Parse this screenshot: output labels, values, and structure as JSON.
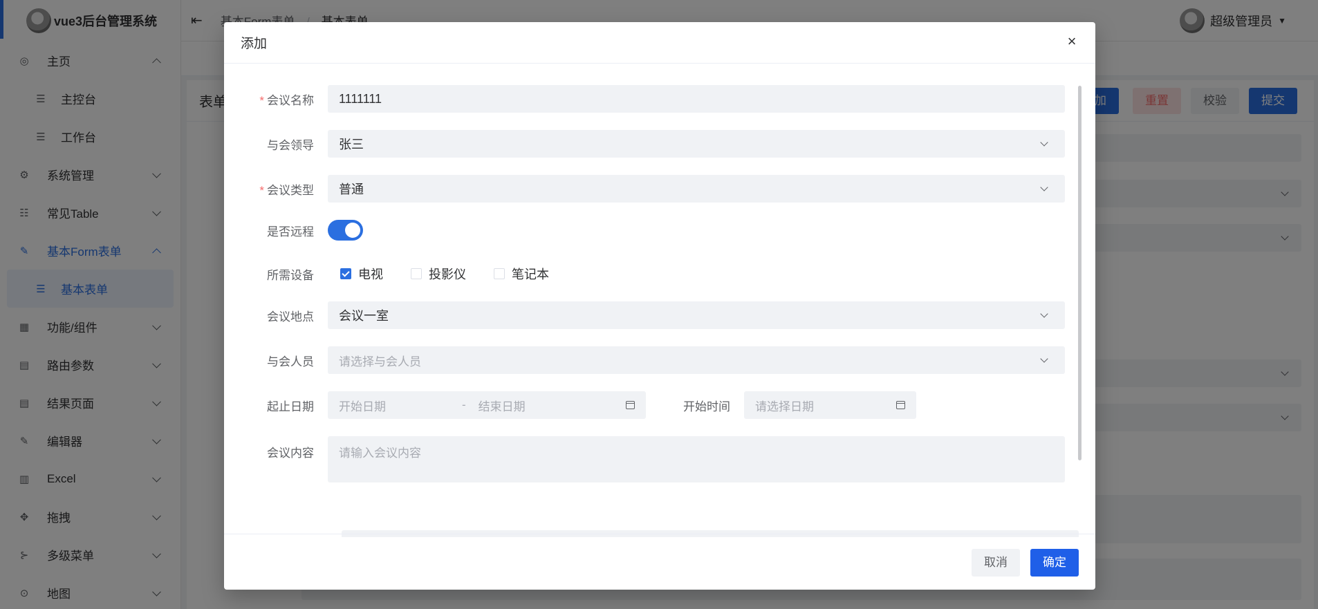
{
  "app": {
    "title": "vue3后台管理系统"
  },
  "sidebar": {
    "items": [
      {
        "label": "主页",
        "icon": "dashboard-icon"
      },
      {
        "label": "主控台",
        "icon": "list-icon"
      },
      {
        "label": "工作台",
        "icon": "list-icon"
      },
      {
        "label": "系统管理",
        "icon": "gear-icon"
      },
      {
        "label": "常见Table",
        "icon": "list-icon"
      },
      {
        "label": "基本Form表单",
        "icon": "edit-icon"
      },
      {
        "label": "基本表单",
        "icon": "list-icon"
      },
      {
        "label": "功能/组件",
        "icon": "grid-icon"
      },
      {
        "label": "路由参数",
        "icon": "document-icon"
      },
      {
        "label": "结果页面",
        "icon": "document-icon"
      },
      {
        "label": "编辑器",
        "icon": "edit-icon"
      },
      {
        "label": "Excel",
        "icon": "table-icon"
      },
      {
        "label": "拖拽",
        "icon": "move-icon"
      },
      {
        "label": "多级菜单",
        "icon": "share-icon"
      },
      {
        "label": "地图",
        "icon": "location-icon"
      }
    ]
  },
  "header": {
    "breadcrumb": [
      "基本Form表单",
      "基本表单"
    ],
    "user": "超级管理员"
  },
  "page": {
    "card_title": "表单",
    "buttons": {
      "add": "添加",
      "reset": "重置",
      "validate": "校验",
      "submit": "提交"
    }
  },
  "dialog": {
    "title": "添加",
    "close": "×",
    "form": {
      "name": {
        "label": "会议名称",
        "value": "1111111",
        "required": true
      },
      "leader": {
        "label": "与会领导",
        "value": "张三"
      },
      "type": {
        "label": "会议类型",
        "value": "普通",
        "required": true
      },
      "remote": {
        "label": "是否远程",
        "value": true
      },
      "devices": {
        "label": "所需设备",
        "options": [
          {
            "label": "电视",
            "checked": true
          },
          {
            "label": "投影仪",
            "checked": false
          },
          {
            "label": "笔记本",
            "checked": false
          }
        ]
      },
      "location": {
        "label": "会议地点",
        "value": "会议一室"
      },
      "attendees": {
        "label": "与会人员",
        "placeholder": "请选择与会人员"
      },
      "date_range": {
        "label": "起止日期",
        "start_placeholder": "开始日期",
        "separator": "-",
        "end_placeholder": "结束日期"
      },
      "start_time": {
        "label": "开始时间",
        "placeholder": "请选择日期"
      },
      "content": {
        "label": "会议内容",
        "placeholder": "请输入会议内容"
      }
    },
    "footer": {
      "cancel": "取消",
      "confirm": "确定"
    }
  },
  "colors": {
    "primary": "#1f5fe8",
    "danger": "#f56c6c",
    "overlay": "rgba(0,0,0,0.5)"
  }
}
